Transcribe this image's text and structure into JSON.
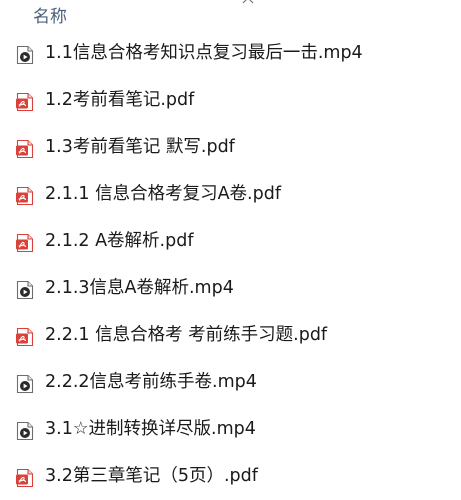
{
  "header": {
    "name_column_label": "名称",
    "sort_icon": "chevron-up-icon"
  },
  "files": [
    {
      "name": "1.1信息合格考知识点复习最后一击.mp4",
      "type": "mp4",
      "icon": "video-file-icon"
    },
    {
      "name": "1.2考前看笔记.pdf",
      "type": "pdf",
      "icon": "pdf-file-icon"
    },
    {
      "name": "1.3考前看笔记 默写.pdf",
      "type": "pdf",
      "icon": "pdf-file-icon"
    },
    {
      "name": "2.1.1 信息合格考复习A卷.pdf",
      "type": "pdf",
      "icon": "pdf-file-icon"
    },
    {
      "name": "2.1.2 A卷解析.pdf",
      "type": "pdf",
      "icon": "pdf-file-icon"
    },
    {
      "name": "2.1.3信息A卷解析.mp4",
      "type": "mp4",
      "icon": "video-file-icon"
    },
    {
      "name": "2.2.1 信息合格考 考前练手习题.pdf",
      "type": "pdf",
      "icon": "pdf-file-icon"
    },
    {
      "name": "2.2.2信息考前练手卷.mp4",
      "type": "mp4",
      "icon": "video-file-icon"
    },
    {
      "name": "3.1☆进制转换详尽版.mp4",
      "type": "mp4",
      "icon": "video-file-icon"
    },
    {
      "name": "3.2第三章笔记（5页）.pdf",
      "type": "pdf",
      "icon": "pdf-file-icon"
    }
  ],
  "colors": {
    "pdf_icon_red": "#d9413a",
    "video_icon_dark": "#2b2b2b",
    "header_text": "#4c607a",
    "file_text": "#1a1a1a"
  }
}
